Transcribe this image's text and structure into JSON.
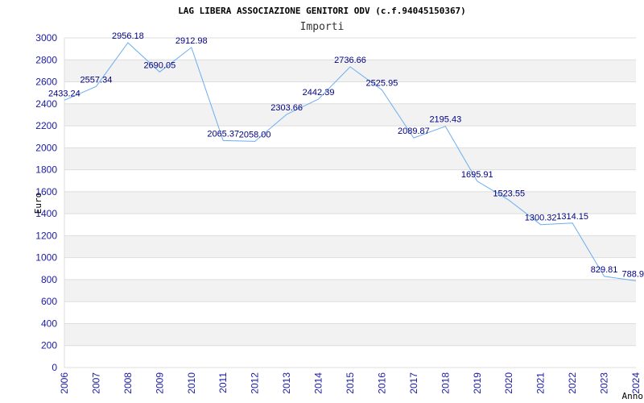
{
  "chart_data": {
    "type": "line",
    "title": "LAG LIBERA ASSOCIAZIONE GENITORI ODV (c.f.94045150367)",
    "subtitle": "Importi",
    "xlabel": "Anno",
    "ylabel": "Euro",
    "x": [
      "2006",
      "2007",
      "2008",
      "2009",
      "2010",
      "2011",
      "2012",
      "2013",
      "2014",
      "2015",
      "2016",
      "2017",
      "2018",
      "2019",
      "2020",
      "2021",
      "2022",
      "2023",
      "2024"
    ],
    "values": [
      2433.24,
      2557.34,
      2956.18,
      2690.05,
      2912.98,
      2065.37,
      2058.0,
      2303.66,
      2442.39,
      2736.66,
      2525.95,
      2089.87,
      2195.43,
      1695.91,
      1523.55,
      1300.32,
      1314.15,
      829.81,
      788.9
    ],
    "labels": [
      "2433.24",
      "2557.34",
      "2956.18",
      "2690.05",
      "2912.98",
      "2065.37",
      "2058.00",
      "2303.66",
      "2442.39",
      "2736.66",
      "2525.95",
      "2089.87",
      "2195.43",
      "1695.91",
      "1523.55",
      "1300.32",
      "1314.15",
      "829.81",
      "788.9"
    ],
    "ylim": [
      0,
      3000
    ],
    "yticks": [
      "0",
      "200",
      "400",
      "600",
      "800",
      "1000",
      "1200",
      "1400",
      "1600",
      "1800",
      "2000",
      "2200",
      "2400",
      "2600",
      "2800",
      "3000"
    ],
    "grid": true,
    "legend": "none",
    "colors": {
      "line": "#6aaef0",
      "band": "#f2f2f2",
      "gridline": "#dddddd",
      "tick_text": "#1a1aa6",
      "label_text": "#000080"
    }
  }
}
